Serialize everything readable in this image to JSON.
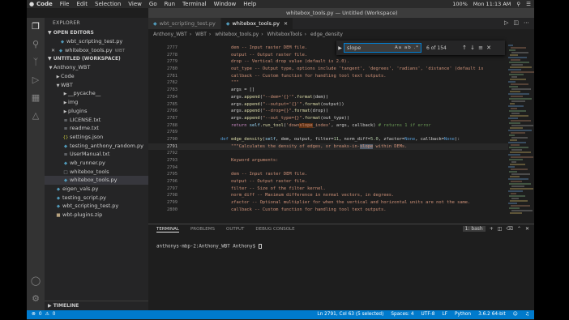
{
  "menubar": {
    "app": "Code",
    "items": [
      "File",
      "Edit",
      "Selection",
      "View",
      "Go",
      "Run",
      "Terminal",
      "Window",
      "Help"
    ],
    "window_title": "whitebox_tools.py — Untitled (Workspace)",
    "battery": "100%",
    "time": "Mon 11:13 AM"
  },
  "sidebar": {
    "title": "EXPLORER",
    "open_editors_label": "OPEN EDITORS",
    "open_editors": [
      {
        "name": "wbt_scripting_test.py",
        "suffix": ""
      },
      {
        "name": "whitebox_tools.py",
        "suffix": "WBT"
      }
    ],
    "workspace_label": "UNTITLED (WORKSPACE)",
    "tree": [
      {
        "name": "Anthony_WBT",
        "kind": "folder",
        "depth": 0
      },
      {
        "name": "Code",
        "kind": "folder-closed",
        "depth": 1
      },
      {
        "name": "WBT",
        "kind": "folder",
        "depth": 1
      },
      {
        "name": "__pycache__",
        "kind": "folder-closed",
        "depth": 2
      },
      {
        "name": "img",
        "kind": "folder-closed",
        "depth": 2
      },
      {
        "name": "plugins",
        "kind": "folder-closed",
        "depth": 2
      },
      {
        "name": "LICENSE.txt",
        "kind": "txt",
        "depth": 2
      },
      {
        "name": "readme.txt",
        "kind": "txt",
        "depth": 2
      },
      {
        "name": "settings.json",
        "kind": "json",
        "depth": 2
      },
      {
        "name": "testing_anthony_random.py",
        "kind": "py",
        "depth": 2
      },
      {
        "name": "UserManual.txt",
        "kind": "txt",
        "depth": 2
      },
      {
        "name": "wb_runner.py",
        "kind": "py",
        "depth": 2
      },
      {
        "name": "whitebox_tools",
        "kind": "bin",
        "depth": 2
      },
      {
        "name": "whitebox_tools.py",
        "kind": "py",
        "depth": 2,
        "selected": true
      },
      {
        "name": "eigen_vals.py",
        "kind": "py",
        "depth": 1
      },
      {
        "name": "testing_script.py",
        "kind": "py",
        "depth": 1
      },
      {
        "name": "wbt_scripting_test.py",
        "kind": "py",
        "depth": 1
      },
      {
        "name": "wbt-plugins.zip",
        "kind": "zip",
        "depth": 1
      }
    ],
    "timeline_label": "TIMELINE"
  },
  "tabs": [
    {
      "label": "wbt_scripting_test.py",
      "active": false
    },
    {
      "label": "whitebox_tools.py",
      "active": true
    }
  ],
  "breadcrumb": [
    "Anthony_WBT",
    "WBT",
    "whitebox_tools.py",
    "WhiteboxTools",
    "edge_density"
  ],
  "find": {
    "query": "slope",
    "options": "Aa  ab  .*",
    "result": "6 of 154"
  },
  "code_lines": [
    {
      "n": "2777",
      "t": "        dem -- Input raster DEM file."
    },
    {
      "n": "2778",
      "t": "        output -- Output raster file."
    },
    {
      "n": "2779",
      "t": "        drop -- Vertical drop value (default is 2.0)."
    },
    {
      "n": "2780",
      "t": "        out_type -- Output type, options include 'tangent', 'degrees', 'radians', 'distance' (default is"
    },
    {
      "n": "2781",
      "t": "        callback -- Custom function for handling tool text outputs."
    },
    {
      "n": "2782",
      "t": "        \"\"\""
    },
    {
      "n": "2783",
      "t": "        args = []"
    },
    {
      "n": "2784",
      "t": "        args.append(\"--dem='{}'\".format(dem))"
    },
    {
      "n": "2785",
      "t": "        args.append(\"--output='{}'\".format(output))"
    },
    {
      "n": "2786",
      "t": "        args.append(\"--drop={}\".format(drop))"
    },
    {
      "n": "2787",
      "t": "        args.append(\"--out_type={}\".format(out_type))"
    },
    {
      "n": "2788",
      "t": "        return self.run_tool('downslope_index', args, callback) # returns 1 if error"
    },
    {
      "n": "2789",
      "t": ""
    },
    {
      "n": "2790",
      "t": "    def edge_density(self, dem, output, filter=11, norm_diff=5.0, zfactor=None, callback=None):"
    },
    {
      "n": "2791",
      "t": "        \"\"\"Calculates the density of edges, or breaks-in-slope within DEMs."
    },
    {
      "n": "2792",
      "t": ""
    },
    {
      "n": "2793",
      "t": "        Keyword arguments:"
    },
    {
      "n": "2794",
      "t": ""
    },
    {
      "n": "2795",
      "t": "        dem -- Input raster DEM file."
    },
    {
      "n": "2796",
      "t": "        output -- Output raster file."
    },
    {
      "n": "2797",
      "t": "        filter -- Size of the filter kernel."
    },
    {
      "n": "2798",
      "t": "        norm_diff -- Maximum difference in normal vectors, in degrees."
    },
    {
      "n": "2799",
      "t": "        zfactor -- Optional multiplier for when the vertical and horizontal units are not the same."
    },
    {
      "n": "2800",
      "t": "        callback -- Custom function for handling tool text outputs."
    }
  ],
  "panel": {
    "tabs": [
      "TERMINAL",
      "PROBLEMS",
      "OUTPUT",
      "DEBUG CONSOLE"
    ],
    "shell_select": "1: bash",
    "prompt": "anthonys-mbp-2:Anthony_WBT Anthony$ "
  },
  "status": {
    "errors": "0",
    "warnings": "0",
    "position": "Ln 2791, Col 63 (5 selected)",
    "spaces": "Spaces: 4",
    "encoding": "UTF-8",
    "eol": "LF",
    "language": "Python",
    "interpreter": "3.6.2 64-bit"
  },
  "colors": {
    "statusbar": "#007acc",
    "sidebar": "#252526",
    "editor": "#1e1e1e",
    "activity": "#333333"
  }
}
